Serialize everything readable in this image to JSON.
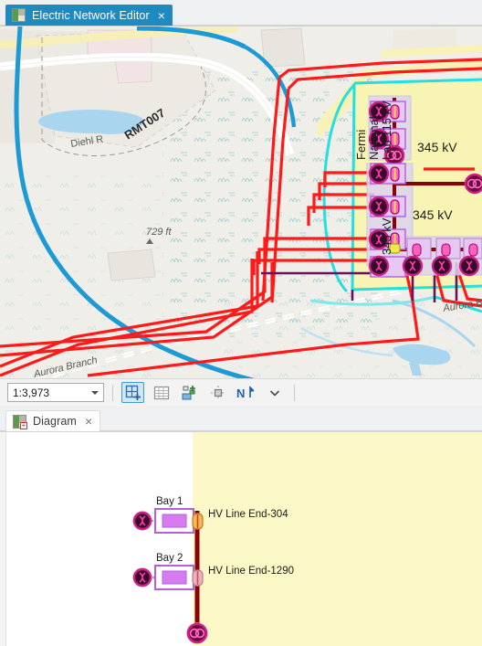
{
  "window": {
    "tabs": [
      {
        "id": "map",
        "label": "Electric Network Editor",
        "icon": "map-tab-icon",
        "close": "×",
        "active": true
      },
      {
        "id": "diagram",
        "label": "Diagram",
        "icon": "diagram-tab-icon",
        "close": "×",
        "active": false
      }
    ]
  },
  "map": {
    "scale": {
      "value": "1:3,973",
      "placeholder": "1:3,973"
    },
    "toolbar": [
      {
        "name": "create-features-button",
        "icon": "grid-plus-icon",
        "selected": true
      },
      {
        "name": "attribute-table-button",
        "icon": "table-icon",
        "selected": false
      },
      {
        "name": "add-to-diagram-button",
        "icon": "diagram-add-icon",
        "selected": false
      },
      {
        "name": "trace-button",
        "icon": "trace-icon",
        "selected": false
      },
      {
        "name": "north-arrow-button",
        "icon": "north-arrow-icon",
        "selected": false
      },
      {
        "name": "more-options-button",
        "icon": "chevron-down-icon",
        "selected": false
      }
    ],
    "labels": {
      "road_diehl": "Diehl R",
      "route_rmt007": "RMT007",
      "elevation": "729 ft",
      "creek_left": "Aurora Branch",
      "creek_right": "Aurora B",
      "substation_name_l1": "Fermi",
      "substation_name_l2": "National",
      "substation_name_l3": "Lab 115 kV",
      "bus_345_vertical": "345 kV",
      "line_345_upper": "345 kV",
      "line_345_lower": "345 kV"
    },
    "colors": {
      "land": "#efeee9",
      "parcel": "#e8e6df",
      "water": "#a9d5ef",
      "stream": "#1b9ad6",
      "substation_fill": "#f7f4b4",
      "substation_outline": "#22e0e0",
      "primary_line": "#ff1a1a",
      "secondary_line": "#6a1060",
      "bus": "#8b0000",
      "device": "#cc1f8a",
      "highlight": "#d8d2f0"
    }
  },
  "diagram": {
    "background": "#ffffff",
    "zone_fill": "#fdf8c8",
    "bus_color": "#8b0000",
    "device_fill": "#d7a0ee",
    "device_stroke": "#b45fe0",
    "nodes": [
      {
        "id": "bay1",
        "label": "Bay 1",
        "endpoint": "HV Line End-304"
      },
      {
        "id": "bay2",
        "label": "Bay 2",
        "endpoint": "HV Line End-1290"
      }
    ],
    "terminal": {
      "id": "bus-terminal",
      "icon": "transformer-node-icon"
    }
  }
}
